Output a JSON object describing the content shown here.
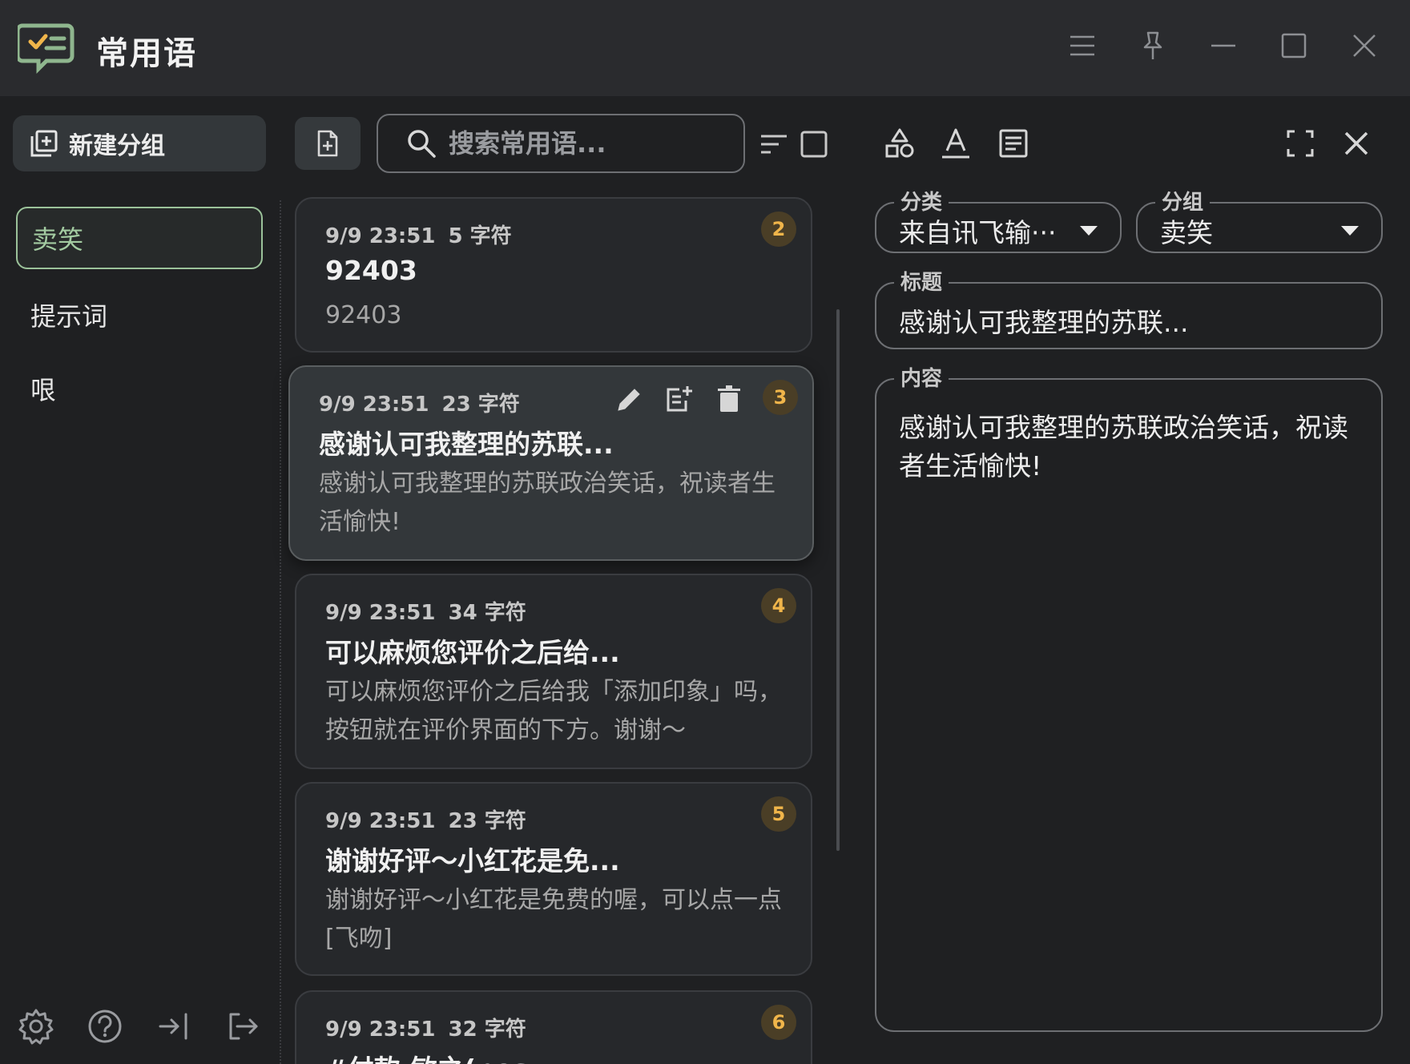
{
  "app": {
    "title": "常用语"
  },
  "sidebar": {
    "new_group_label": "新建分组",
    "groups": [
      {
        "label": "卖笑",
        "active": true
      },
      {
        "label": "提示词",
        "active": false
      },
      {
        "label": "哏",
        "active": false
      }
    ]
  },
  "search": {
    "placeholder": "搜索常用语..."
  },
  "cards": [
    {
      "date": "9/9 23:51",
      "count": "5 字符",
      "badge": "2",
      "title": "92403",
      "body": "92403"
    },
    {
      "date": "9/9 23:51",
      "count": "23 字符",
      "badge": "3",
      "title": "感谢认可我整理的苏联...",
      "body": "感谢认可我整理的苏联政治笑话，祝读者生活愉快!"
    },
    {
      "date": "9/9 23:51",
      "count": "34 字符",
      "badge": "4",
      "title": "可以麻烦您评价之后给...",
      "body": "可以麻烦您评价之后给我「添加印象」吗，按钮就在评价界面的下方。谢谢～"
    },
    {
      "date": "9/9 23:51",
      "count": "23 字符",
      "badge": "5",
      "title": "谢谢好评～小红花是免...",
      "body": "谢谢好评～小红花是免费的喔，可以点一点[飞吻]"
    },
    {
      "date": "9/9 23:51",
      "count": "32 字符",
      "badge": "6",
      "title": "#付款:敏之(pos...",
      "body": ""
    }
  ],
  "detail": {
    "category_label": "分类",
    "category_value": "来自讯飞输···",
    "group_label": "分组",
    "group_value": "卖笑",
    "title_label": "标题",
    "title_value": "感谢认可我整理的苏联...",
    "content_label": "内容",
    "content_value": "感谢认可我整理的苏联政治笑话，祝读者生活愉快!"
  },
  "colors": {
    "accent": "#9bc29a",
    "badge_text": "#f0b54a",
    "badge_bg": "#4a3e26",
    "background": "#1f2022"
  }
}
